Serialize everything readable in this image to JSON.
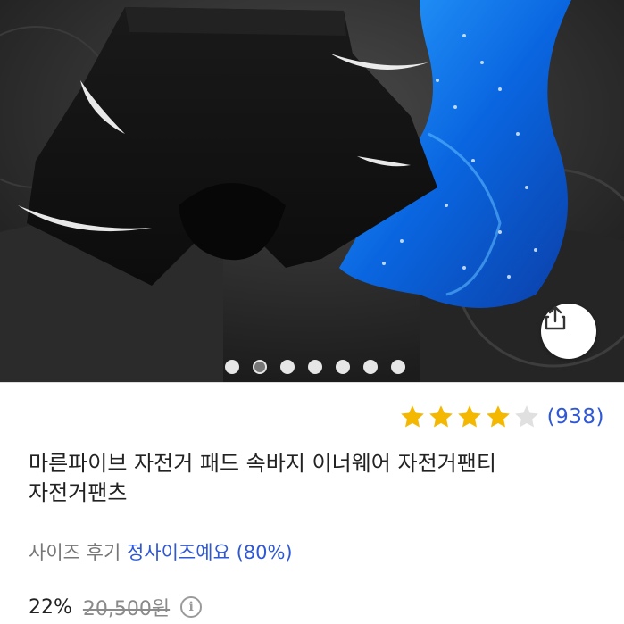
{
  "gallery": {
    "slide_count": 7,
    "active_index": 1,
    "image_alt": "black padded cycling shorts with blue gel pad and feathers"
  },
  "share": {
    "icon": "share-icon"
  },
  "rating": {
    "stars": 4,
    "max": 5,
    "count_text": "(938)",
    "star_color": "#f5b800",
    "empty_star_color": "#e0e0e0"
  },
  "product": {
    "title": "마른파이브 자전거 패드 속바지 이너웨어 자전거팬티 자전거팬츠"
  },
  "size_review": {
    "label": "사이즈 후기",
    "value": "정사이즈예요 (80%)"
  },
  "price": {
    "discount": "22%",
    "original": "20,500원",
    "info_icon": "info-icon"
  },
  "colors": {
    "link_blue": "#2f58d6"
  }
}
